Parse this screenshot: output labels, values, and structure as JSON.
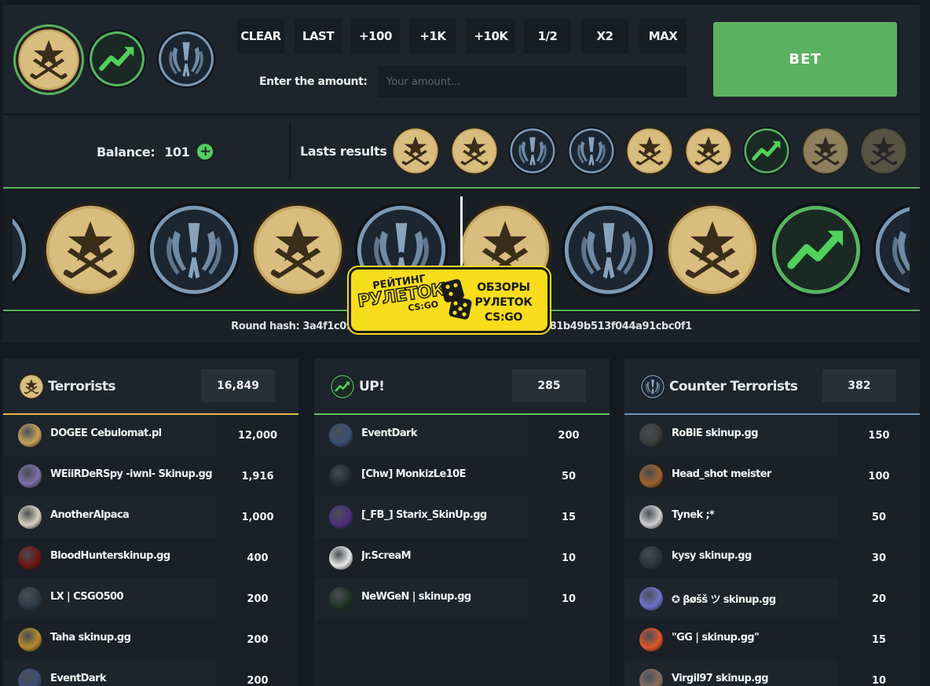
{
  "controls": {
    "chips": [
      {
        "kind": "t",
        "selected": true
      },
      {
        "kind": "up",
        "selected": false
      },
      {
        "kind": "ct",
        "selected": false
      }
    ],
    "buttons": [
      "CLEAR",
      "LAST",
      "+100",
      "+1K",
      "+10K",
      "1/2",
      "X2",
      "MAX"
    ],
    "amount_label": "Enter the amount:",
    "amount_placeholder": "Your amount...",
    "amount_value": "",
    "bet_label": "BET"
  },
  "balance": {
    "label": "Balance:",
    "value": "101"
  },
  "lasts": {
    "label": "Lasts results",
    "results": [
      "t",
      "t",
      "ct",
      "ct",
      "t",
      "t",
      "up",
      "t",
      "t"
    ]
  },
  "strip": {
    "items": [
      "ct",
      "t",
      "ct",
      "t",
      "ct",
      "t",
      "ct",
      "t",
      "up",
      "ct"
    ]
  },
  "round": {
    "hash_text": "Round hash: 3a4f1c09",
    "hash_tail": "81b49b513f044a91cbc0f1"
  },
  "logo": {
    "line1": "РЕЙТИНГ",
    "line2": "РУЛЕТОК",
    "line3": "CS:GO",
    "right": [
      "ОБЗОРЫ",
      "РУЛЕТОК",
      "CS:GO"
    ]
  },
  "colors": {
    "accent_green": "#5cb15f",
    "t_line": "#e2b94e",
    "up_line": "#66c46a",
    "ct_line": "#6b93b7"
  },
  "tables": [
    {
      "kind": "t",
      "title": "Terrorists",
      "total": "16,849",
      "rows": [
        {
          "name": "DOGEE Cebulomat.pl",
          "amount": "12,000",
          "avatar": "#c9a25a"
        },
        {
          "name": "WEiiRDeRSpy -iwnl- Skinup.gg",
          "amount": "1,916",
          "avatar": "#7d6ea8"
        },
        {
          "name": "AnotherAlpaca",
          "amount": "1,000",
          "avatar": "#d8d2bf"
        },
        {
          "name": "BloodHunterskinup.gg",
          "amount": "400",
          "avatar": "#6e1414"
        },
        {
          "name": "LX | CSGO500",
          "amount": "200",
          "avatar": "#2d3a46"
        },
        {
          "name": "Taha skinup.gg",
          "amount": "200",
          "avatar": "#b58b2d"
        },
        {
          "name": "EventDark",
          "amount": "200",
          "avatar": "#3a4f73"
        }
      ]
    },
    {
      "kind": "up",
      "title": "UP!",
      "total": "285",
      "rows": [
        {
          "name": "EventDark",
          "amount": "200",
          "avatar": "#3a4f73"
        },
        {
          "name": "[Chw] MonkizLe10E",
          "amount": "50",
          "avatar": "#222a31"
        },
        {
          "name": "[_FB_] Starix_SkinUp.gg",
          "amount": "15",
          "avatar": "#4b2f7a"
        },
        {
          "name": "Jr.ScreaM",
          "amount": "10",
          "avatar": "#e8e8e8"
        },
        {
          "name": "NeWGeN | skinup.gg",
          "amount": "10",
          "avatar": "#203226"
        }
      ]
    },
    {
      "kind": "ct",
      "title": "Counter Terrorists",
      "total": "382",
      "rows": [
        {
          "name": "RoBiE skinup.gg",
          "amount": "150",
          "avatar": "#3b3b3b"
        },
        {
          "name": "Head_shot meister",
          "amount": "100",
          "avatar": "#a0612a"
        },
        {
          "name": "Tynek ;*",
          "amount": "50",
          "avatar": "#cfcfcf"
        },
        {
          "name": "kysy skinup.gg",
          "amount": "30",
          "avatar": "#2c3238"
        },
        {
          "name": "✪ βøšš ツ skinup.gg",
          "amount": "20",
          "avatar": "#6d72c8"
        },
        {
          "name": "\"GG | skinup.gg\"",
          "amount": "15",
          "avatar": "#e0552a"
        },
        {
          "name": "Virgil97 skinup.gg",
          "amount": "10",
          "avatar": "#8a6d5e"
        }
      ]
    }
  ]
}
